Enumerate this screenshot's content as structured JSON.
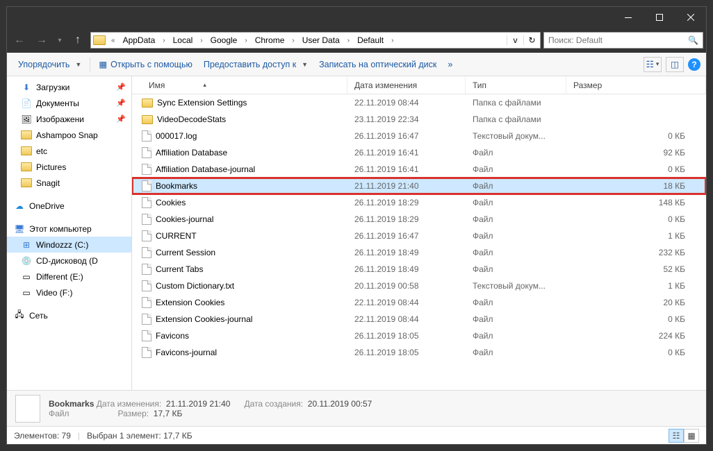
{
  "breadcrumb": [
    "AppData",
    "Local",
    "Google",
    "Chrome",
    "User Data",
    "Default"
  ],
  "search": {
    "placeholder": "Поиск: Default"
  },
  "toolbar": {
    "organize": "Упорядочить",
    "open_with": "Открыть с помощью",
    "share": "Предоставить доступ к",
    "burn": "Записать на оптический диск",
    "overflow": "»"
  },
  "columns": {
    "name": "Имя",
    "date": "Дата изменения",
    "type": "Тип",
    "size": "Размер"
  },
  "sidebar": {
    "downloads": "Загрузки",
    "documents": "Документы",
    "pictures_lib": "Изображени",
    "ashampoo": "Ashampoo Snap",
    "etc": "etc",
    "pictures": "Pictures",
    "snagit": "Snagit",
    "onedrive": "OneDrive",
    "this_pc": "Этот компьютер",
    "windozzz": "Windozzz (C:)",
    "cd": "CD-дисковод (D",
    "different": "Different (E:)",
    "video": "Video (F:)",
    "network": "Сеть"
  },
  "files": [
    {
      "name": "Sync Extension Settings",
      "date": "22.11.2019 08:44",
      "type": "Папка с файлами",
      "size": "",
      "kind": "folder"
    },
    {
      "name": "VideoDecodeStats",
      "date": "23.11.2019 22:34",
      "type": "Папка с файлами",
      "size": "",
      "kind": "folder"
    },
    {
      "name": "000017.log",
      "date": "26.11.2019 16:47",
      "type": "Текстовый докум...",
      "size": "0 КБ",
      "kind": "file"
    },
    {
      "name": "Affiliation Database",
      "date": "26.11.2019 16:41",
      "type": "Файл",
      "size": "92 КБ",
      "kind": "file"
    },
    {
      "name": "Affiliation Database-journal",
      "date": "26.11.2019 16:41",
      "type": "Файл",
      "size": "0 КБ",
      "kind": "file"
    },
    {
      "name": "Bookmarks",
      "date": "21.11.2019 21:40",
      "type": "Файл",
      "size": "18 КБ",
      "kind": "file",
      "selected": true,
      "highlighted": true
    },
    {
      "name": "Cookies",
      "date": "26.11.2019 18:29",
      "type": "Файл",
      "size": "148 КБ",
      "kind": "file"
    },
    {
      "name": "Cookies-journal",
      "date": "26.11.2019 18:29",
      "type": "Файл",
      "size": "0 КБ",
      "kind": "file"
    },
    {
      "name": "CURRENT",
      "date": "26.11.2019 16:47",
      "type": "Файл",
      "size": "1 КБ",
      "kind": "file"
    },
    {
      "name": "Current Session",
      "date": "26.11.2019 18:49",
      "type": "Файл",
      "size": "232 КБ",
      "kind": "file"
    },
    {
      "name": "Current Tabs",
      "date": "26.11.2019 18:49",
      "type": "Файл",
      "size": "52 КБ",
      "kind": "file"
    },
    {
      "name": "Custom Dictionary.txt",
      "date": "20.11.2019 00:58",
      "type": "Текстовый докум...",
      "size": "1 КБ",
      "kind": "file"
    },
    {
      "name": "Extension Cookies",
      "date": "22.11.2019 08:44",
      "type": "Файл",
      "size": "20 КБ",
      "kind": "file"
    },
    {
      "name": "Extension Cookies-journal",
      "date": "22.11.2019 08:44",
      "type": "Файл",
      "size": "0 КБ",
      "kind": "file"
    },
    {
      "name": "Favicons",
      "date": "26.11.2019 18:05",
      "type": "Файл",
      "size": "224 КБ",
      "kind": "file"
    },
    {
      "name": "Favicons-journal",
      "date": "26.11.2019 18:05",
      "type": "Файл",
      "size": "0 КБ",
      "kind": "file"
    }
  ],
  "details": {
    "filename": "Bookmarks",
    "filetype": "Файл",
    "mod_label": "Дата изменения:",
    "mod_value": "21.11.2019 21:40",
    "created_label": "Дата создания:",
    "created_value": "20.11.2019 00:57",
    "size_label": "Размер:",
    "size_value": "17,7 КБ"
  },
  "status": {
    "items": "Элементов: 79",
    "selection": "Выбран 1 элемент: 17,7 КБ"
  }
}
